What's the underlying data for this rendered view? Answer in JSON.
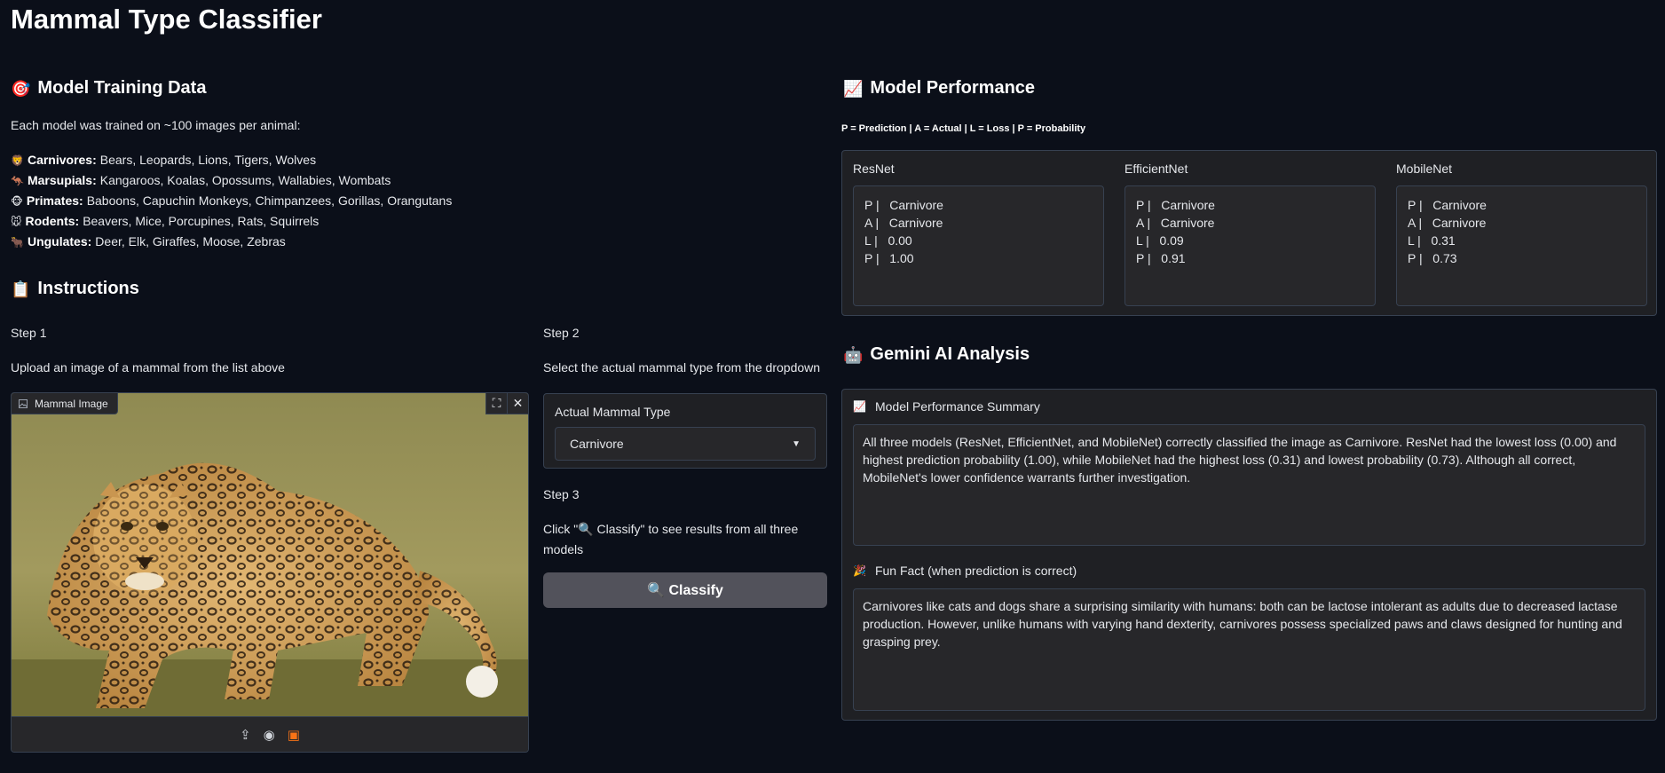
{
  "page": {
    "title": "Mammal Type Classifier"
  },
  "training": {
    "icon": "🎯",
    "heading": "Model Training Data",
    "intro": "Each model was trained on ~100 images per animal:",
    "categories": [
      {
        "emoji": "🦁",
        "name": "Carnivores:",
        "animals": "Bears, Leopards, Lions, Tigers, Wolves"
      },
      {
        "emoji": "🦘",
        "name": "Marsupials:",
        "animals": "Kangaroos, Koalas, Opossums, Wallabies, Wombats"
      },
      {
        "emoji": "🐵",
        "name": "Primates:",
        "animals": "Baboons, Capuchin Monkeys, Chimpanzees, Gorillas, Orangutans"
      },
      {
        "emoji": "🐭",
        "name": "Rodents:",
        "animals": "Beavers, Mice, Porcupines, Rats, Squirrels"
      },
      {
        "emoji": "🐂",
        "name": "Ungulates:",
        "animals": "Deer, Elk, Giraffes, Moose, Zebras"
      }
    ]
  },
  "instructions": {
    "icon": "📋",
    "heading": "Instructions",
    "step1": {
      "label": "Step 1",
      "text": "Upload an image of a mammal from the list above"
    },
    "step2": {
      "label": "Step 2",
      "text": "Select the actual mammal type from the dropdown"
    },
    "step3": {
      "label": "Step 3",
      "text": "Click \"🔍 Classify\" to see results from all three models"
    }
  },
  "image_input": {
    "label": "Mammal Image",
    "label_icon": "image-icon"
  },
  "dropdown": {
    "label": "Actual Mammal Type",
    "value": "Carnivore"
  },
  "classify_button": {
    "label": "🔍 Classify"
  },
  "performance": {
    "icon": "📈",
    "heading": "Model Performance",
    "legend": "P = Prediction | A = Actual | L = Loss | P = Probability",
    "models": [
      {
        "name": "ResNet",
        "lines": [
          "P |   Carnivore",
          "A |   Carnivore",
          "L |   0.00",
          "P |   1.00"
        ]
      },
      {
        "name": "EfficientNet",
        "lines": [
          "P |   Carnivore",
          "A |   Carnivore",
          "L |   0.09",
          "P |   0.91"
        ]
      },
      {
        "name": "MobileNet",
        "lines": [
          "P |   Carnivore",
          "A |   Carnivore",
          "L |   0.31",
          "P |   0.73"
        ]
      }
    ]
  },
  "gemini": {
    "icon": "🤖",
    "heading": "Gemini AI Analysis",
    "summary_icon": "📈",
    "summary_label": "Model Performance Summary",
    "summary_text": "All three models (ResNet, EfficientNet, and MobileNet) correctly classified the image as Carnivore. ResNet had the lowest loss (0.00) and highest prediction probability (1.00), while MobileNet had the highest loss (0.31) and lowest probability (0.73). Although all correct, MobileNet's lower confidence warrants further investigation.",
    "fact_icon": "🎉",
    "fact_label": "Fun Fact (when prediction is correct)",
    "fact_text": "Carnivores like cats and dogs share a surprising similarity with humans: both can be lactose intolerant as adults due to decreased lactase production. However, unlike humans with varying hand dexterity, carnivores possess specialized paws and claws designed for hunting and grasping prey."
  }
}
